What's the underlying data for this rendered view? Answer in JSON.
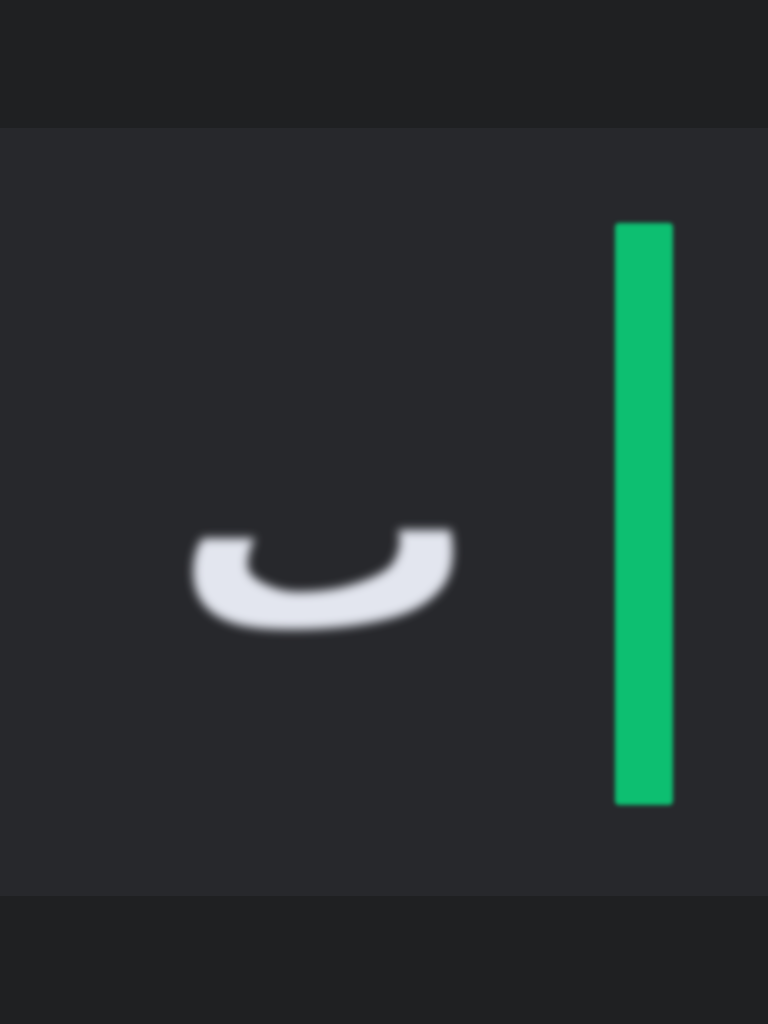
{
  "row": {
    "label": "ب"
  },
  "indicator": {
    "color": "#0dbf71",
    "state": "active"
  },
  "colors": {
    "background": "#1f2022",
    "row_background": "#27282c",
    "label_text": "#e3e6ef"
  }
}
